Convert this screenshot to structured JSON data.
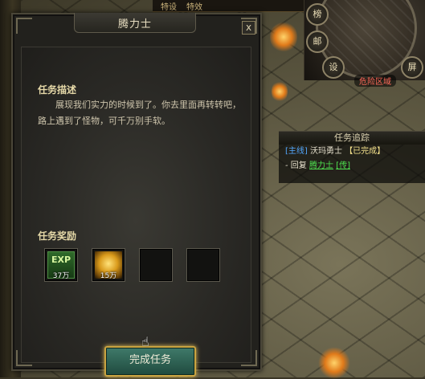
{
  "dialog": {
    "title": "腾力士",
    "close_label": "x",
    "description_title": "任务描述",
    "description_line1": "展现我们实力的时候到了。你去里面再转转吧，",
    "description_line2": "路上遇到了怪物，可千万别手软。",
    "rewards_title": "任务奖励",
    "rewards": [
      {
        "icon": "exp-icon",
        "label": "EXP",
        "count": "37万"
      },
      {
        "icon": "gold-coin-icon",
        "count": "15万"
      },
      {
        "icon": "empty-slot"
      },
      {
        "icon": "empty-slot"
      }
    ],
    "complete_button": "完成任务"
  },
  "minimap": {
    "buttons": [
      "榜",
      "邮",
      "设",
      "屏"
    ],
    "zone_label": "危险区域"
  },
  "tracker": {
    "title": "任务追踪",
    "main_tag": "[主线]",
    "main_quest": "沃玛勇士",
    "main_status": "【已完成】",
    "reply_prefix": "- 回复",
    "npc_name": "腾力士",
    "npc_action": "[传]"
  },
  "top_banner": {
    "items": [
      "特设",
      "特效"
    ]
  },
  "colors": {
    "panel_bg": "#22211d",
    "title_text": "#e9dfc2",
    "section_title": "#e6d9a8",
    "button_border": "#c9a441",
    "tracker_tag": "#53a9ff",
    "npc_link": "#4fe04f",
    "danger": "#ff6a5a"
  }
}
